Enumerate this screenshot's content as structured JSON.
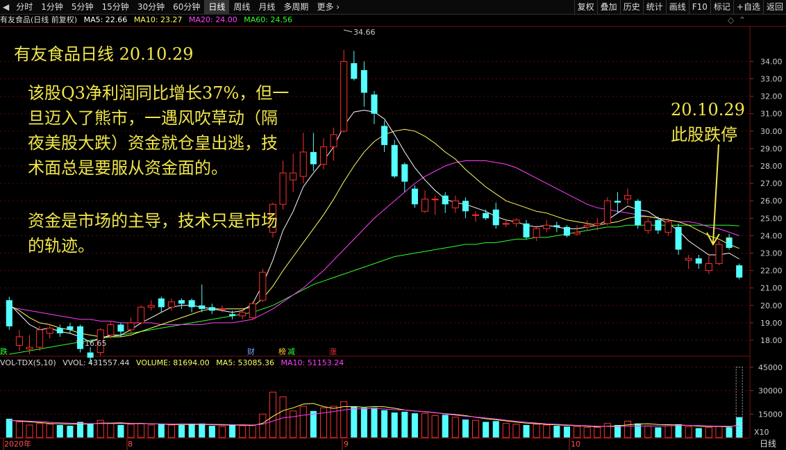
{
  "toolbar": {
    "periods": [
      "分时",
      "1分钟",
      "5分钟",
      "15分钟",
      "30分钟",
      "60分钟",
      "日线",
      "周线",
      "月线",
      "多周期",
      "更多"
    ],
    "active_period": "日线",
    "right_buttons": [
      "复权",
      "叠加",
      "历史",
      "统计",
      "画线",
      "F10",
      "标记",
      "+自选",
      "返回"
    ],
    "back_icon": "left-triangle-icon",
    "more_icon": "chevron-right-icon"
  },
  "info": {
    "title": "有友食品(日线 前复权)",
    "ma5": "MA5: 22.66",
    "ma10": "MA10: 23.27",
    "ma20": "MA20: 24.00",
    "ma60": "MA60: 24.56"
  },
  "colors": {
    "up": "#ff3030",
    "down": "#54ffff",
    "ma5": "#ffffff",
    "ma10": "#ffff60",
    "ma20": "#ff40ff",
    "ma60": "#30ff30",
    "annotation": "#f0e64a"
  },
  "annotations": {
    "title": "有友食品日线 20.10.29",
    "para1": [
      "该股Q3净利润同比增长37%，但一",
      "旦迈入了熊市，一遇风吹草动（隔",
      "夜美股大跌）资金就仓皇出逃，技",
      "术面总是要服从资金面的。"
    ],
    "para2": [
      "资金是市场的主导，技术只是市场",
      "的轨迹。"
    ],
    "right": [
      "20.10.29",
      "此股跌停"
    ]
  },
  "markers": {
    "die": "跌",
    "cai": "财",
    "bang": "榜",
    "jian": "减",
    "zhang": "涨",
    "high_label": "34.66",
    "low_label": "16.65"
  },
  "vol_info": {
    "name": "VOL-TDX(5,10)",
    "vvol": "VVOL: 431557.44",
    "volume": "VOLUME: 81694.00",
    "ma5": "MA5: 53085.36",
    "ma10": "MA10: 51153.24",
    "x10": "X10"
  },
  "bottom": {
    "year": "2020年",
    "months": [
      "8",
      "9",
      "10"
    ],
    "right_label": "日线"
  },
  "chart_data": {
    "type": "candlestick",
    "price_axis_ticks": [
      18,
      19,
      20,
      21,
      22,
      23,
      24,
      25,
      26,
      27,
      28,
      29,
      30,
      31,
      32,
      33,
      34
    ],
    "volume_axis_ticks": [
      15000,
      30000,
      45000
    ],
    "candles": [
      [
        20.3,
        18.8,
        20.5,
        18.6
      ],
      [
        17.7,
        18.2,
        18.6,
        17.4
      ],
      [
        17.5,
        17.6,
        18.3,
        17.2
      ],
      [
        17.6,
        18.6,
        18.8,
        17.4
      ],
      [
        18.4,
        18.7,
        18.9,
        18.1
      ],
      [
        18.7,
        18.4,
        18.9,
        18.2
      ],
      [
        18.8,
        18.6,
        19.0,
        18.4
      ],
      [
        18.8,
        17.5,
        18.9,
        17.3
      ],
      [
        17.3,
        17.0,
        17.6,
        16.65
      ],
      [
        17.3,
        18.6,
        18.7,
        17.1
      ],
      [
        18.3,
        18.9,
        19.1,
        18.1
      ],
      [
        18.9,
        18.5,
        19.0,
        18.2
      ],
      [
        18.6,
        19.0,
        19.3,
        18.4
      ],
      [
        19.0,
        19.9,
        20.0,
        18.9
      ],
      [
        19.9,
        20.0,
        20.3,
        19.7
      ],
      [
        20.4,
        19.9,
        20.5,
        19.6
      ],
      [
        19.9,
        20.2,
        20.4,
        19.7
      ],
      [
        20.3,
        20.1,
        20.4,
        19.8
      ],
      [
        20.3,
        19.9,
        20.4,
        19.6
      ],
      [
        20.0,
        19.8,
        21.2,
        19.6
      ],
      [
        19.9,
        19.7,
        20.1,
        19.5
      ],
      [
        19.8,
        19.8,
        20.0,
        19.6
      ],
      [
        19.5,
        19.4,
        19.7,
        19.2
      ],
      [
        19.4,
        19.6,
        19.8,
        19.2
      ],
      [
        19.3,
        20.1,
        20.2,
        19.2
      ],
      [
        20.3,
        21.9,
        22.1,
        20.2
      ],
      [
        24.2,
        25.8,
        25.9,
        23.9
      ],
      [
        25.8,
        27.6,
        28.3,
        25.5
      ],
      [
        27.2,
        27.6,
        28.7,
        26.5
      ],
      [
        27.4,
        28.8,
        29.9,
        27.0
      ],
      [
        28.8,
        28.1,
        29.9,
        27.7
      ],
      [
        28.1,
        29.1,
        29.6,
        27.8
      ],
      [
        29.1,
        29.8,
        30.2,
        28.3
      ],
      [
        30.0,
        34.0,
        34.66,
        29.9
      ],
      [
        33.9,
        33.0,
        34.6,
        32.9
      ],
      [
        33.5,
        32.2,
        34.0,
        31.4
      ],
      [
        32.1,
        31.0,
        32.3,
        30.4
      ],
      [
        30.3,
        29.2,
        30.6,
        28.8
      ],
      [
        29.2,
        27.4,
        29.5,
        27.3
      ],
      [
        28.1,
        27.1,
        28.2,
        26.5
      ],
      [
        26.7,
        25.8,
        26.9,
        25.6
      ],
      [
        25.4,
        26.1,
        26.6,
        25.3
      ],
      [
        26.1,
        26.1,
        26.3,
        25.2
      ],
      [
        26.3,
        25.8,
        26.5,
        25.3
      ],
      [
        25.6,
        26.0,
        26.3,
        25.3
      ],
      [
        26.0,
        25.4,
        26.2,
        25.0
      ],
      [
        25.2,
        25.2,
        25.4,
        24.8
      ],
      [
        25.3,
        25.0,
        25.5,
        24.9
      ],
      [
        25.5,
        24.6,
        25.9,
        24.4
      ],
      [
        24.7,
        24.7,
        24.9,
        24.5
      ],
      [
        24.7,
        24.9,
        25.0,
        24.5
      ],
      [
        24.7,
        23.9,
        24.9,
        23.8
      ],
      [
        23.9,
        24.4,
        24.6,
        23.7
      ],
      [
        24.4,
        24.6,
        24.9,
        24.2
      ],
      [
        24.6,
        24.5,
        24.8,
        24.2
      ],
      [
        24.5,
        24.0,
        24.6,
        23.9
      ],
      [
        24.1,
        24.2,
        24.6,
        24.0
      ],
      [
        24.5,
        24.6,
        24.9,
        24.3
      ],
      [
        24.6,
        24.7,
        25.0,
        24.3
      ],
      [
        24.7,
        26.0,
        26.2,
        24.6
      ],
      [
        26.0,
        25.9,
        26.5,
        25.3
      ],
      [
        26.1,
        26.3,
        26.7,
        25.8
      ],
      [
        26.0,
        24.6,
        26.1,
        24.4
      ],
      [
        24.3,
        24.8,
        25.0,
        24.1
      ],
      [
        24.9,
        24.3,
        25.1,
        24.1
      ],
      [
        24.2,
        24.8,
        25.0,
        24.0
      ],
      [
        24.5,
        23.2,
        24.7,
        22.9
      ],
      [
        22.6,
        22.7,
        22.9,
        22.1
      ],
      [
        22.7,
        22.4,
        22.9,
        22.1
      ],
      [
        22.0,
        22.4,
        22.9,
        21.8
      ],
      [
        22.4,
        23.5,
        23.7,
        22.3
      ],
      [
        23.9,
        23.3,
        24.1,
        23.2
      ],
      [
        22.3,
        21.6,
        22.4,
        21.5
      ]
    ],
    "ma5": [
      20.1,
      19.5,
      18.9,
      18.6,
      18.7,
      18.5,
      18.4,
      18.2,
      17.9,
      18.1,
      18.3,
      18.3,
      18.6,
      19.0,
      19.3,
      19.6,
      19.9,
      20.0,
      20.0,
      19.9,
      19.8,
      19.7,
      19.6,
      19.7,
      20.1,
      21.2,
      22.6,
      24.3,
      25.4,
      26.8,
      27.6,
      28.3,
      29.1,
      30.3,
      31.1,
      31.2,
      31.1,
      30.7,
      29.8,
      28.8,
      27.9,
      27.2,
      26.6,
      26.1,
      25.9,
      25.8,
      25.6,
      25.4,
      25.1,
      24.9,
      24.8,
      24.6,
      24.5,
      24.6,
      24.5,
      24.4,
      24.4,
      24.5,
      24.6,
      24.9,
      25.3,
      25.7,
      25.5,
      25.4,
      25.0,
      24.7,
      24.3,
      23.7,
      23.3,
      22.9,
      22.9,
      23.0,
      22.66
    ],
    "ma10": [
      20.0,
      19.7,
      19.3,
      19.0,
      18.9,
      18.7,
      18.6,
      18.4,
      18.3,
      18.2,
      18.2,
      18.2,
      18.3,
      18.5,
      18.7,
      18.9,
      19.1,
      19.3,
      19.5,
      19.7,
      19.8,
      19.8,
      19.8,
      19.8,
      19.9,
      20.4,
      21.1,
      22.0,
      22.8,
      23.6,
      24.4,
      25.2,
      26.1,
      27.1,
      28.0,
      28.8,
      29.4,
      29.8,
      30.0,
      30.1,
      30.0,
      29.7,
      29.3,
      28.8,
      28.4,
      27.8,
      27.3,
      26.8,
      26.4,
      26.0,
      25.8,
      25.6,
      25.4,
      25.3,
      25.1,
      24.9,
      24.8,
      24.7,
      24.6,
      24.7,
      24.8,
      25.0,
      25.1,
      25.1,
      25.0,
      24.9,
      24.8,
      24.6,
      24.3,
      24.0,
      23.8,
      23.5,
      23.27
    ],
    "ma20": [
      19.9,
      19.8,
      19.7,
      19.6,
      19.5,
      19.4,
      19.3,
      19.2,
      19.2,
      19.1,
      19.1,
      19.0,
      19.0,
      19.0,
      19.0,
      18.9,
      18.9,
      18.9,
      18.9,
      18.9,
      19.0,
      19.0,
      19.0,
      19.1,
      19.2,
      19.5,
      19.8,
      20.2,
      20.6,
      21.0,
      21.5,
      22.0,
      22.6,
      23.2,
      23.8,
      24.4,
      25.0,
      25.5,
      26.0,
      26.5,
      27.0,
      27.4,
      27.7,
      28.0,
      28.2,
      28.3,
      28.3,
      28.3,
      28.2,
      28.1,
      27.9,
      27.6,
      27.3,
      27.0,
      26.7,
      26.4,
      26.1,
      25.8,
      25.6,
      25.5,
      25.4,
      25.3,
      25.2,
      25.1,
      25.0,
      24.9,
      24.8,
      24.8,
      24.7,
      24.5,
      24.4,
      24.2,
      24.0
    ],
    "ma60": [
      17.2,
      17.3,
      17.4,
      17.5,
      17.6,
      17.7,
      17.8,
      17.9,
      18.0,
      18.1,
      18.2,
      18.3,
      18.4,
      18.5,
      18.6,
      18.7,
      18.8,
      18.9,
      19.0,
      19.1,
      19.2,
      19.3,
      19.4,
      19.5,
      19.6,
      19.8,
      20.0,
      20.3,
      20.6,
      20.9,
      21.2,
      21.4,
      21.6,
      21.8,
      22.0,
      22.2,
      22.4,
      22.6,
      22.8,
      22.9,
      23.0,
      23.1,
      23.2,
      23.3,
      23.4,
      23.5,
      23.5,
      23.6,
      23.6,
      23.7,
      23.8,
      23.8,
      23.9,
      23.9,
      24.0,
      24.1,
      24.2,
      24.3,
      24.4,
      24.5,
      24.5,
      24.6,
      24.6,
      24.6,
      24.6,
      24.6,
      24.6,
      24.6,
      24.6,
      24.6,
      24.6,
      24.6,
      24.56
    ],
    "volume": [
      12000,
      10000,
      8000,
      9000,
      8500,
      8000,
      7500,
      10000,
      9000,
      11000,
      9000,
      8000,
      8500,
      9000,
      8000,
      8500,
      8000,
      8000,
      8500,
      9000,
      7500,
      7000,
      8000,
      7500,
      8000,
      15000,
      29000,
      26000,
      17000,
      20000,
      17000,
      19000,
      20000,
      23000,
      20000,
      19000,
      19000,
      17500,
      16000,
      16500,
      15500,
      15500,
      14000,
      14500,
      13000,
      11500,
      11000,
      10000,
      10500,
      9000,
      8500,
      8000,
      8500,
      8000,
      7500,
      7000,
      7000,
      6500,
      6500,
      9000,
      8000,
      10500,
      9000,
      7500,
      6500,
      7500,
      8500,
      7000,
      6000,
      6500,
      7000,
      6500,
      13000
    ],
    "vol_ma5": [
      11000,
      10500,
      10000,
      9600,
      9000,
      8800,
      8600,
      8600,
      8600,
      9200,
      9200,
      9400,
      9000,
      9000,
      8800,
      8600,
      8300,
      8300,
      8400,
      8400,
      8200,
      8000,
      8000,
      8000,
      7600,
      9100,
      13500,
      17200,
      19000,
      21400,
      21800,
      19800,
      18600,
      19800,
      19800,
      19400,
      19800,
      19700,
      18700,
      17600,
      17000,
      16500,
      15900,
      15200,
      14700,
      14000,
      13000,
      12000,
      11400,
      10600,
      9900,
      9200,
      8900,
      8400,
      8100,
      7800,
      7600,
      7200,
      6900,
      7200,
      7400,
      8100,
      8600,
      8800,
      8300,
      8200,
      8000,
      7800,
      7200,
      7100,
      7100,
      6800,
      8000
    ],
    "vol_ma10": [
      11000,
      10800,
      10500,
      10200,
      9800,
      9500,
      9200,
      9000,
      8900,
      9000,
      8900,
      8900,
      8800,
      8800,
      8800,
      8700,
      8600,
      8700,
      8700,
      8600,
      8500,
      8400,
      8200,
      8200,
      8000,
      8500,
      10500,
      12600,
      13300,
      14300,
      15000,
      15800,
      16600,
      17600,
      18300,
      18300,
      18600,
      18200,
      17800,
      17600,
      16900,
      16600,
      16000,
      15000,
      14300,
      13600,
      13100,
      12500,
      11900,
      11100,
      10400,
      9800,
      9300,
      8700,
      8500,
      8100,
      7800,
      7500,
      7200,
      7100,
      7000,
      7300,
      7400,
      7300,
      7400,
      7500,
      7700,
      7800,
      7600,
      7400,
      7300,
      7200,
      7500
    ]
  }
}
